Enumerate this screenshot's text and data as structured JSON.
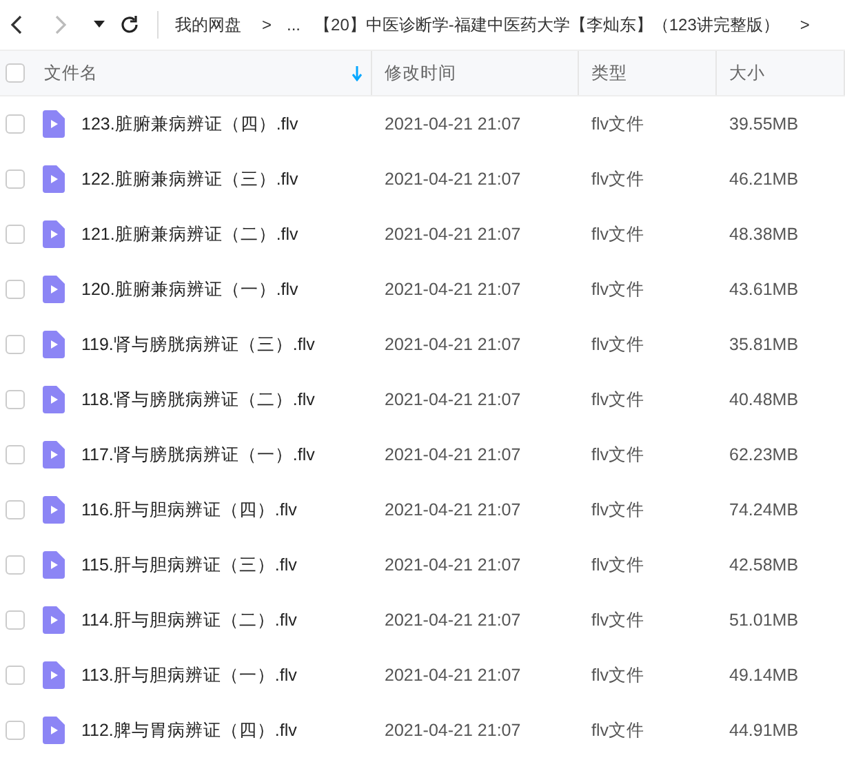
{
  "toolbar": {
    "back_disabled": false,
    "forward_disabled": true
  },
  "breadcrumb": [
    {
      "kind": "link",
      "text": "我的网盘"
    },
    {
      "kind": "sep",
      "text": ">"
    },
    {
      "kind": "link",
      "text": "..."
    },
    {
      "kind": "link",
      "text": "【20】中医诊断学-福建中医药大学【李灿东】（123讲完整版）"
    },
    {
      "kind": "sep",
      "text": ">"
    }
  ],
  "table": {
    "all_checked": false,
    "columns": [
      {
        "label": "文件名",
        "sorted": true
      },
      {
        "label": "修改时间",
        "sorted": false
      },
      {
        "label": "类型",
        "sorted": false
      },
      {
        "label": "大小",
        "sorted": false
      }
    ],
    "rows": [
      {
        "checked": false,
        "name": "123.脏腑兼病辨证（四）.flv",
        "modified": "2021-04-21 21:07",
        "type": "flv文件",
        "size": "39.55MB"
      },
      {
        "checked": false,
        "name": "122.脏腑兼病辨证（三）.flv",
        "modified": "2021-04-21 21:07",
        "type": "flv文件",
        "size": "46.21MB"
      },
      {
        "checked": false,
        "name": "121.脏腑兼病辨证（二）.flv",
        "modified": "2021-04-21 21:07",
        "type": "flv文件",
        "size": "48.38MB"
      },
      {
        "checked": false,
        "name": "120.脏腑兼病辨证（一）.flv",
        "modified": "2021-04-21 21:07",
        "type": "flv文件",
        "size": "43.61MB"
      },
      {
        "checked": false,
        "name": "119.肾与膀胱病辨证（三）.flv",
        "modified": "2021-04-21 21:07",
        "type": "flv文件",
        "size": "35.81MB"
      },
      {
        "checked": false,
        "name": "118.肾与膀胱病辨证（二）.flv",
        "modified": "2021-04-21 21:07",
        "type": "flv文件",
        "size": "40.48MB"
      },
      {
        "checked": false,
        "name": "117.肾与膀胱病辨证（一）.flv",
        "modified": "2021-04-21 21:07",
        "type": "flv文件",
        "size": "62.23MB"
      },
      {
        "checked": false,
        "name": "116.肝与胆病辨证（四）.flv",
        "modified": "2021-04-21 21:07",
        "type": "flv文件",
        "size": "74.24MB"
      },
      {
        "checked": false,
        "name": "115.肝与胆病辨证（三）.flv",
        "modified": "2021-04-21 21:07",
        "type": "flv文件",
        "size": "42.58MB"
      },
      {
        "checked": false,
        "name": "114.肝与胆病辨证（二）.flv",
        "modified": "2021-04-21 21:07",
        "type": "flv文件",
        "size": "51.01MB"
      },
      {
        "checked": false,
        "name": "113.肝与胆病辨证（一）.flv",
        "modified": "2021-04-21 21:07",
        "type": "flv文件",
        "size": "49.14MB"
      },
      {
        "checked": false,
        "name": "112.脾与胃病辨证（四）.flv",
        "modified": "2021-04-21 21:07",
        "type": "flv文件",
        "size": "44.91MB"
      }
    ]
  }
}
